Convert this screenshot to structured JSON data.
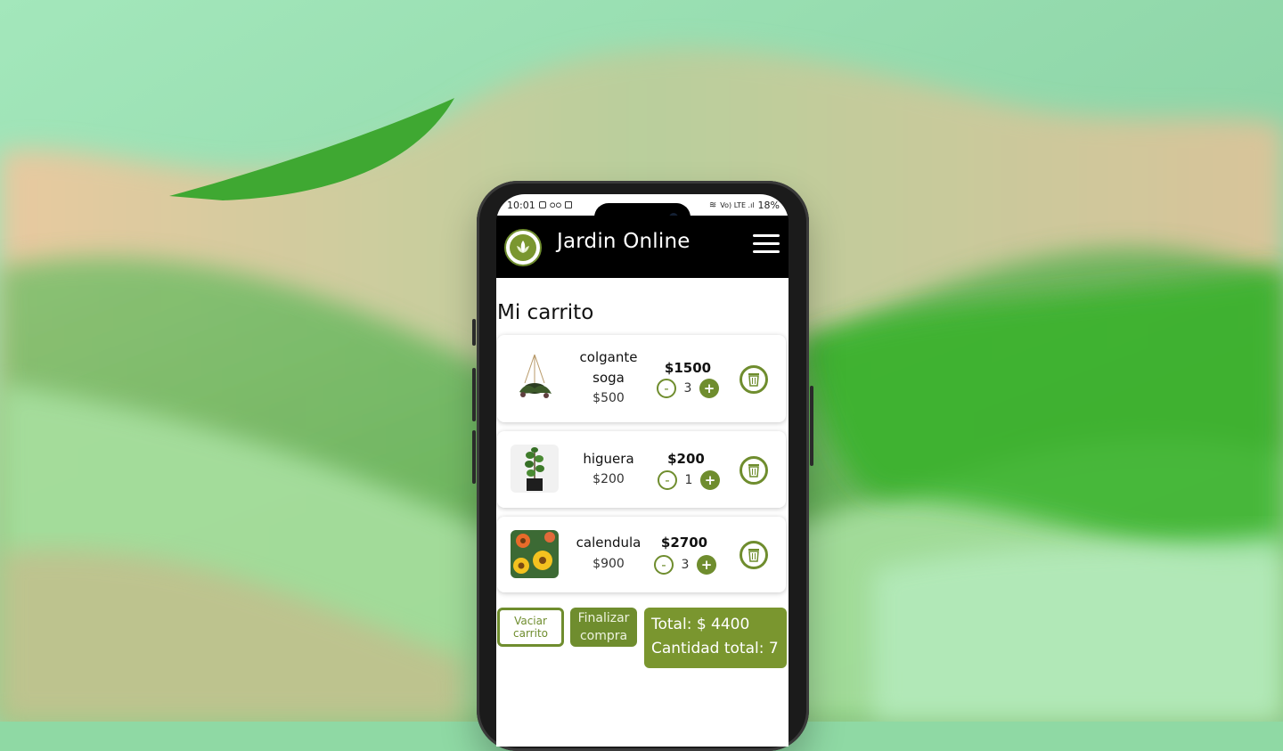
{
  "statusbar": {
    "time": "10:01",
    "left_icons": [
      "photo-icon",
      "voicemail-icon",
      "lock-icon"
    ],
    "right_indicators": "Vo) LTE .ıl",
    "battery": "18%"
  },
  "navbar": {
    "brand": "Jardin Online"
  },
  "page": {
    "title": "Mi carrito"
  },
  "cart": {
    "items": [
      {
        "name_line1": "colgante",
        "name_line2": "soga",
        "unit_price": "$500",
        "subtotal": "$1500",
        "qty": "3",
        "minus": "-",
        "plus": "+"
      },
      {
        "name_line1": "higuera",
        "name_line2": "",
        "unit_price": "$200",
        "subtotal": "$200",
        "qty": "1",
        "minus": "-",
        "plus": "+"
      },
      {
        "name_line1": "calendula",
        "name_line2": "",
        "unit_price": "$900",
        "subtotal": "$2700",
        "qty": "3",
        "minus": "-",
        "plus": "+"
      }
    ],
    "clear_line1": "Vaciar",
    "clear_line2": "carrito",
    "finish_line1": "Finalizar",
    "finish_line2": "compra",
    "total": "Total: $ 4400",
    "total_qty": "Cantidad total: 7"
  },
  "colors": {
    "accent": "#6f8d2e",
    "accent_light": "#7a962f",
    "background": "#8fd9a4"
  }
}
